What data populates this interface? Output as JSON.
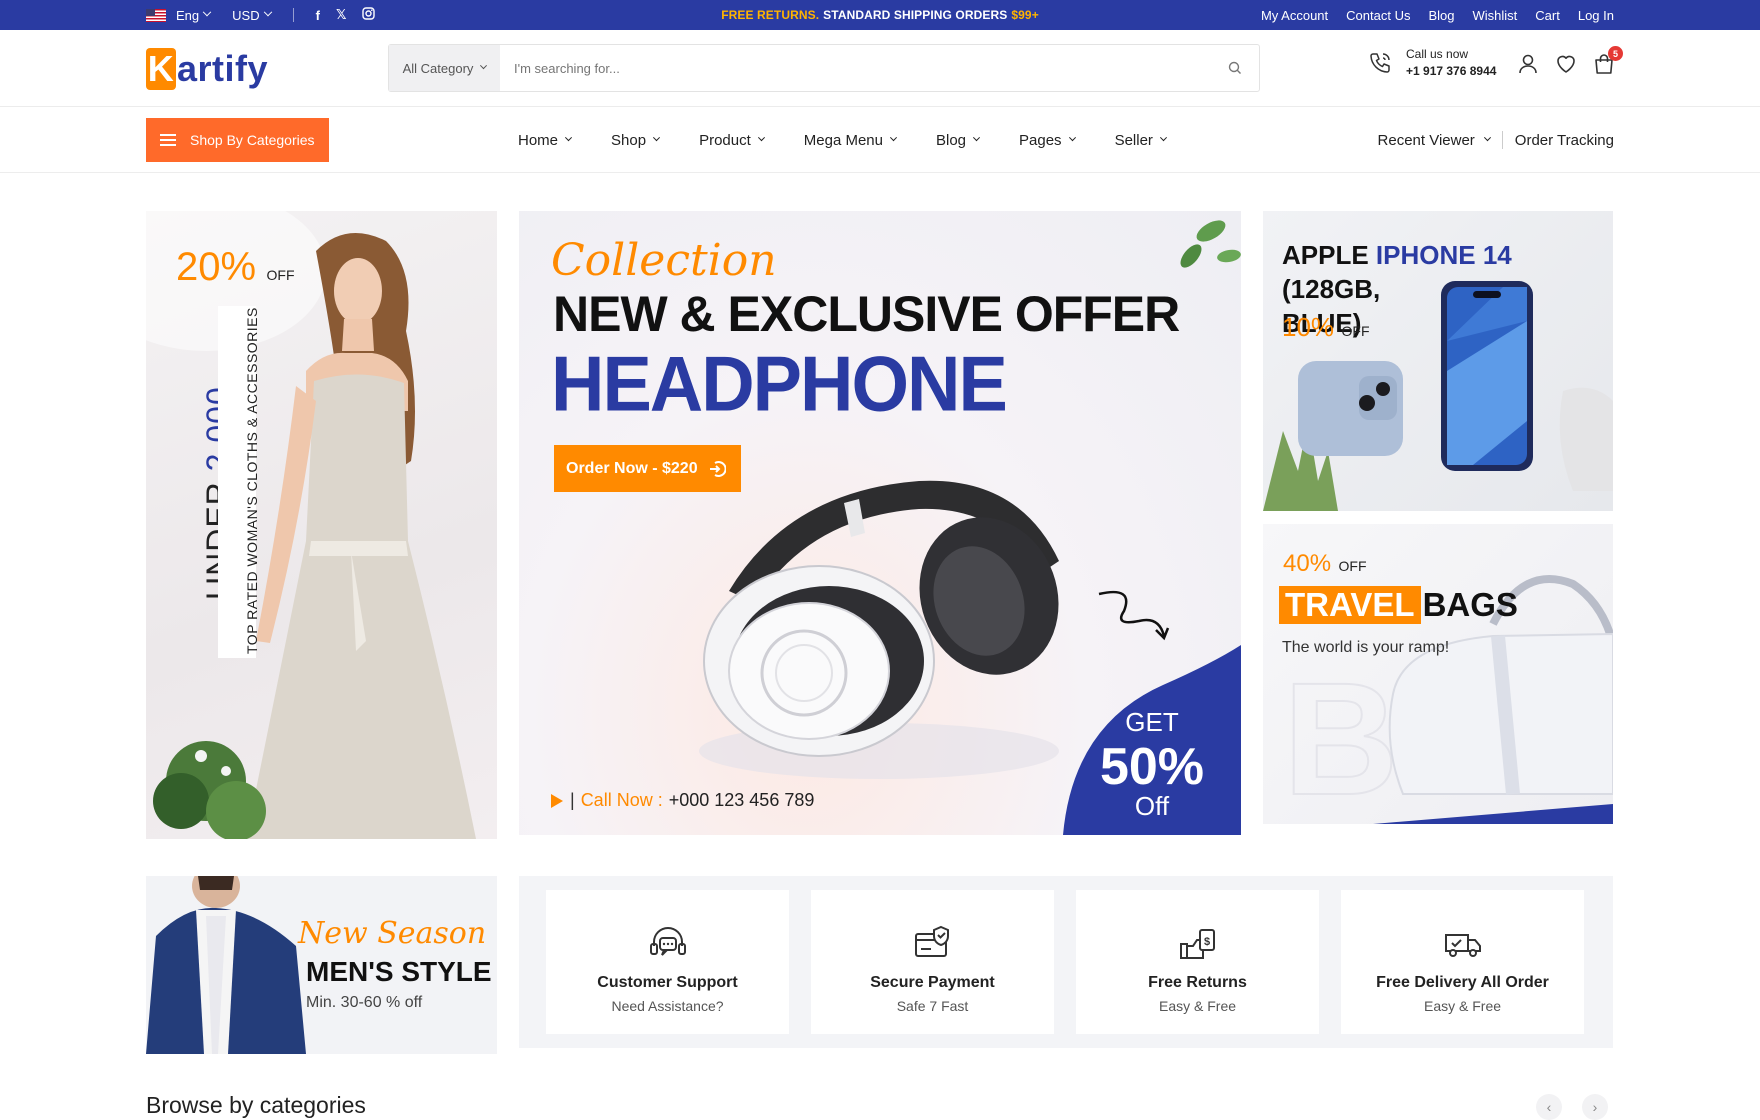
{
  "topbar": {
    "language": "Eng",
    "currency": "USD",
    "social": [
      "f",
      "X",
      "ig"
    ],
    "promo_highlight": "FREE RETURNS.",
    "promo_text": "STANDARD SHIPPING ORDERS",
    "promo_amount": "$99+",
    "links": [
      "My Account",
      "Contact Us",
      "Blog",
      "Wishlist",
      "Cart",
      "Log In"
    ]
  },
  "header": {
    "logo_k": "K",
    "logo_rest": "artify",
    "search_category": "All Category",
    "search_placeholder": "I'm searching for...",
    "call_label": "Call us now",
    "call_number": "+1 917 376 8944",
    "cart_count": "5"
  },
  "nav": {
    "categories_button": "Shop By Categories",
    "menu": [
      "Home",
      "Shop",
      "Product",
      "Mega Menu",
      "Blog",
      "Pages",
      "Seller"
    ],
    "recent_viewer": "Recent Viewer",
    "order_tracking": "Order Tracking"
  },
  "banner_fashion": {
    "pct": "20%",
    "off": "OFF",
    "under": "UNDER",
    "amount": "2,000",
    "vertical_text": "TOP RATED WOMAN'S CLOTHS & ACCESSORIES"
  },
  "banner_headphone": {
    "script": "Collection",
    "headline": "NEW & EXCLUSIVE OFFER",
    "product": "HEADPHONE",
    "cta": "Order Now - $220",
    "call_label": "Call Now :",
    "call_number": "+000 123 456 789",
    "get": "GET",
    "get_pct": "50%",
    "get_off": "Off"
  },
  "banner_iphone": {
    "title_a": "APPLE",
    "title_b": "IPHONE 14",
    "title_c": "(128GB,",
    "title_d": "BLUE)",
    "pct": "10%",
    "off": "OFF"
  },
  "banner_bags": {
    "pct": "40%",
    "off": "OFF",
    "highlight": "TRAVEL",
    "word": "BAGS",
    "tagline": "The world is your ramp!"
  },
  "banner_men": {
    "script": "New Season",
    "title": "MEN'S STYLE",
    "sub": "Min. 30-60 % off"
  },
  "features": [
    {
      "title": "Customer Support",
      "sub": "Need Assistance?",
      "icon": "headset-icon"
    },
    {
      "title": "Secure Payment",
      "sub": "Safe 7 Fast",
      "icon": "secure-card-icon"
    },
    {
      "title": "Free Returns",
      "sub": "Easy & Free",
      "icon": "returns-icon"
    },
    {
      "title": "Free Delivery All Order",
      "sub": "Easy & Free",
      "icon": "delivery-truck-icon"
    }
  ],
  "browse": {
    "title": "Browse by categories",
    "prev": "‹",
    "next": "›"
  },
  "colors": {
    "brand_blue": "#2a3ba2",
    "accent_orange": "#ff8a00",
    "category_button": "#ff6a2a"
  }
}
